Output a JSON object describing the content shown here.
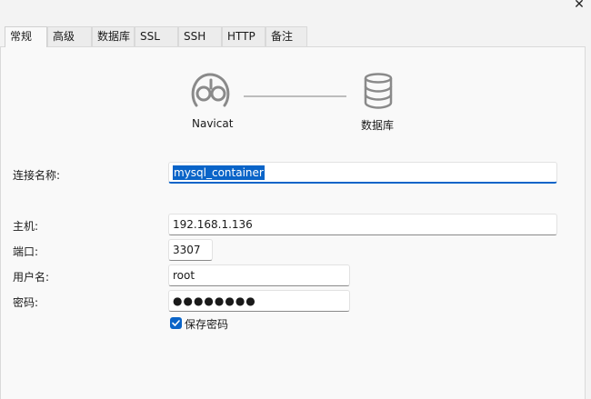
{
  "window": {
    "close_glyph": "✕"
  },
  "tabs": [
    {
      "label": "常规",
      "active": true
    },
    {
      "label": "高级",
      "active": false
    },
    {
      "label": "数据库",
      "active": false
    },
    {
      "label": "SSL",
      "active": false
    },
    {
      "label": "SSH",
      "active": false
    },
    {
      "label": "HTTP",
      "active": false
    },
    {
      "label": "备注",
      "active": false
    }
  ],
  "diagram": {
    "left_caption": "Navicat",
    "right_caption": "数据库",
    "left_icon": "navicat-logo-icon",
    "right_icon": "database-icon"
  },
  "form": {
    "connection_name": {
      "label": "连接名称:",
      "value": "mysql_container",
      "selected": true
    },
    "host": {
      "label": "主机:",
      "value": "192.168.1.136"
    },
    "port": {
      "label": "端口:",
      "value": "3307"
    },
    "username": {
      "label": "用户名:",
      "value": "root"
    },
    "password": {
      "label": "密码:",
      "value": "●●●●●●●●"
    },
    "save_password": {
      "label": "保存密码",
      "checked": true
    }
  },
  "colors": {
    "accent": "#0a64c8",
    "panel": "#f9f9f9",
    "background": "#f3f3f3"
  }
}
